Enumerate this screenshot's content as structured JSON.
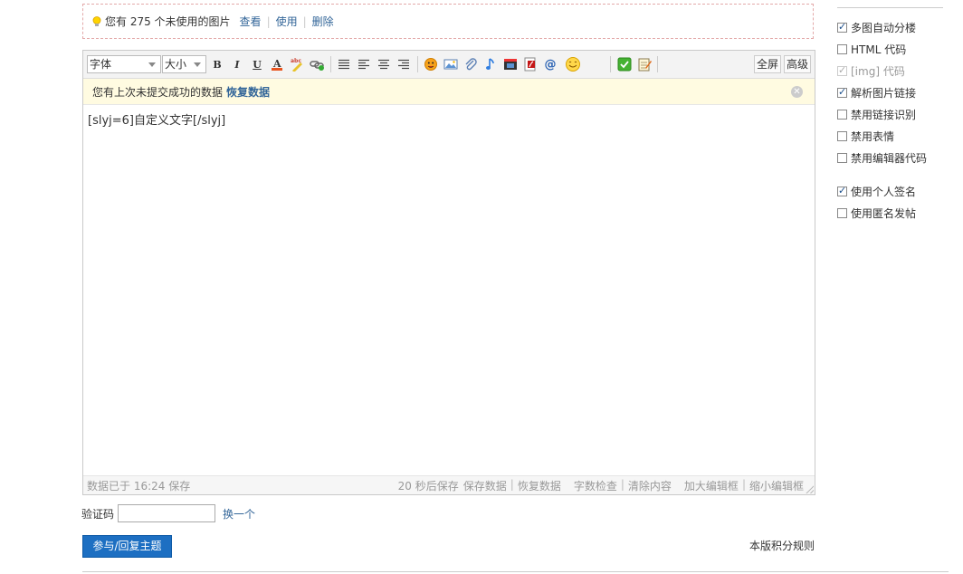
{
  "notice": {
    "text": "您有 275 个未使用的图片",
    "view": "查看",
    "use": "使用",
    "delete": "删除"
  },
  "toolbar": {
    "font_label": "字体",
    "size_label": "大小",
    "fullscreen": "全屏",
    "advanced": "高级"
  },
  "restore": {
    "text": "您有上次未提交成功的数据",
    "link": "恢复数据",
    "close_icon": "close-icon"
  },
  "editor": {
    "content": "[slyj=6]自定义文字[/slyj]"
  },
  "statusbar": {
    "saved": "数据已于 16:24 保存",
    "autosave": "20 秒后保存",
    "save_data": "保存数据",
    "restore_data": "恢复数据",
    "word_check": "字数检查",
    "clear": "清除内容",
    "enlarge": "加大编辑框",
    "shrink": "缩小编辑框"
  },
  "captcha": {
    "label": "验证码",
    "value": "",
    "refresh": "换一个"
  },
  "submit_label": "参与/回复主题",
  "rules_label": "本版积分规则",
  "options": [
    {
      "label": "多图自动分楼",
      "checked": true,
      "disabled": false
    },
    {
      "label": "HTML 代码",
      "checked": false,
      "disabled": false
    },
    {
      "label": "[img] 代码",
      "checked": true,
      "disabled": true
    },
    {
      "label": "解析图片链接",
      "checked": true,
      "disabled": false
    },
    {
      "label": "禁用链接识别",
      "checked": false,
      "disabled": false
    },
    {
      "label": "禁用表情",
      "checked": false,
      "disabled": false
    },
    {
      "label": "禁用编辑器代码",
      "checked": false,
      "disabled": false
    },
    {
      "label": "使用个人签名",
      "checked": true,
      "disabled": false
    },
    {
      "label": "使用匿名发帖",
      "checked": false,
      "disabled": false
    }
  ],
  "colors": {
    "link": "#336699",
    "submit_bg": "#1d6fc2",
    "restore_bg": "#fffbe1"
  }
}
